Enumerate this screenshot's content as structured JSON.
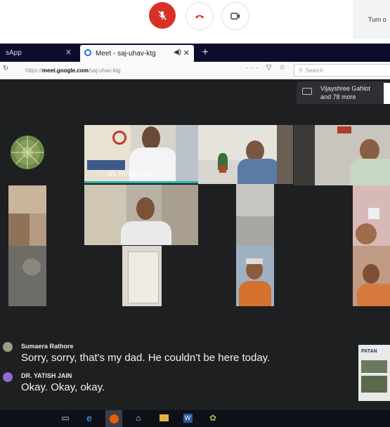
{
  "meet_controls": {
    "turn_on_label": "Turn o"
  },
  "browser": {
    "tabs": [
      {
        "label": "sApp"
      },
      {
        "label": "Meet - saj-uhav-ktg"
      }
    ],
    "close_glyph": "✕",
    "new_tab_glyph": "+",
    "url_prefix": "https://",
    "url_host": "meet.google.com",
    "url_path": "/saj-uhav-ktg",
    "search_placeholder": "Search"
  },
  "meeting": {
    "presenter_line1": "Vijayshree Gahlot",
    "presenter_line2": "and 78 more",
    "tile_name": "DR. YATISH JAIN",
    "captions": [
      {
        "speaker": "Sumaera Rathore",
        "text": "Sorry, sorry, that's my dad. He couldn't be here today."
      },
      {
        "speaker": "DR. YATISH JAIN",
        "text": "Okay. Okay, okay."
      }
    ],
    "pip_label": "PATAN"
  },
  "colors": {
    "mic_off": "#d93025",
    "meet_bg": "#1e1f21",
    "tab_bg": "#0c0c2c"
  }
}
